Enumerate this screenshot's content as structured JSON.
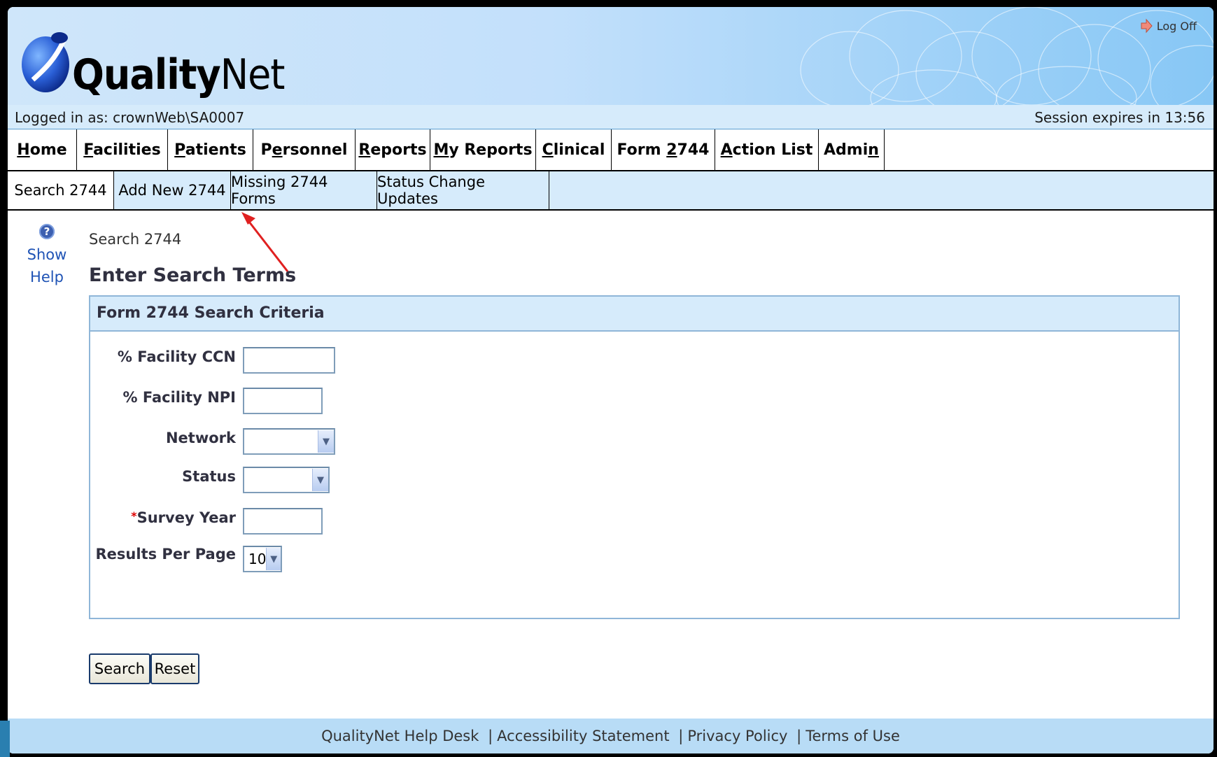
{
  "header": {
    "brand_bold": "Quality",
    "brand_light": "Net",
    "logoff_label": "Log Off",
    "logged_in": "Logged in as: crownWeb\\SA0007",
    "session": "Session expires in 13:56"
  },
  "mainnav": [
    {
      "label": "Home",
      "underline": "H",
      "active": false
    },
    {
      "label": "Facilities",
      "underline": "F",
      "active": false
    },
    {
      "label": "Patients",
      "underline": "P",
      "active": false
    },
    {
      "label": "Personnel",
      "underline": "e",
      "active": false
    },
    {
      "label": "Reports",
      "underline": "R",
      "active": false
    },
    {
      "label": "My Reports",
      "underline": "M",
      "active": false
    },
    {
      "label": "Clinical",
      "underline": "C",
      "active": false
    },
    {
      "label": "Form 2744",
      "underline": "2",
      "active": true
    },
    {
      "label": "Action List",
      "underline": "A",
      "active": false
    },
    {
      "label": "Admin",
      "underline": "n",
      "active": false
    }
  ],
  "subnav": [
    {
      "label": "Search 2744",
      "active": true
    },
    {
      "label": "Add New 2744",
      "active": false
    },
    {
      "label": "Missing 2744 Forms",
      "active": false
    },
    {
      "label": "Status Change Updates",
      "active": false
    }
  ],
  "help": {
    "line1": "Show",
    "line2": "Help"
  },
  "breadcrumb": "Search 2744",
  "page_title": "Enter Search Terms",
  "panel_title": "Form 2744 Search Criteria",
  "form": {
    "facility_ccn": {
      "label": "% Facility CCN",
      "value": ""
    },
    "facility_npi": {
      "label": "% Facility NPI",
      "value": ""
    },
    "network": {
      "label": "Network",
      "value": ""
    },
    "status": {
      "label": "Status",
      "value": ""
    },
    "survey_year": {
      "label": "Survey Year",
      "required_mark": "*",
      "value": ""
    },
    "results_per_page": {
      "label": "Results Per Page",
      "value": "10"
    }
  },
  "buttons": {
    "search": "Search",
    "reset": "Reset"
  },
  "footer": {
    "help_desk": "QualityNet Help Desk",
    "accessibility": "Accessibility Statement",
    "privacy": "Privacy Policy",
    "terms": "Terms of Use",
    "sep": "|"
  },
  "colors": {
    "annotation_arrow": "#e02020",
    "accent": "#d6ebfb",
    "footer": "#b8dcf6"
  }
}
